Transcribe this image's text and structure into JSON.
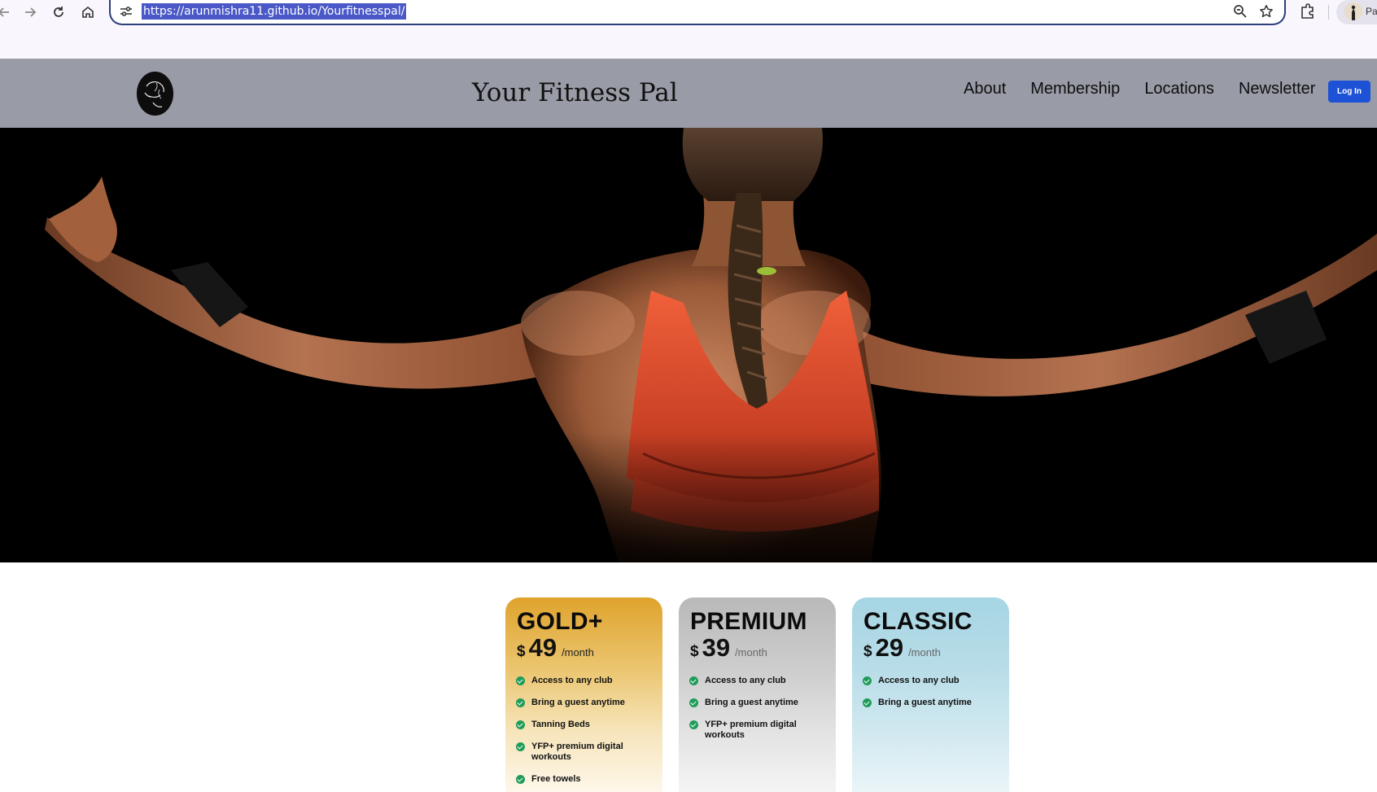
{
  "browser": {
    "url": "https://arunmishra11.github.io/Yourfitnesspal/",
    "profile_label": "Pa",
    "icons": [
      "back-icon",
      "forward-icon",
      "reload-icon",
      "home-icon",
      "site-info-icon",
      "zoom-icon",
      "bookmark-star-icon",
      "extensions-icon",
      "profile-avatar"
    ]
  },
  "header": {
    "title": "Your Fitness Pal",
    "nav": [
      "About",
      "Membership",
      "Locations",
      "Newsletter"
    ],
    "login_label": "Log In",
    "colors": {
      "header_bg": "#999ca6",
      "login_bg": "#1d52d6"
    }
  },
  "plans": [
    {
      "name": "GOLD+",
      "currency": "$",
      "price": "49",
      "period": "/month",
      "features": [
        "Access to any club",
        "Bring a guest anytime",
        "Tanning Beds",
        "YFP+ premium digital workouts",
        "Free towels"
      ],
      "color": "#dfa32c"
    },
    {
      "name": "PREMIUM",
      "currency": "$",
      "price": "39",
      "period": "/month",
      "features": [
        "Access to any club",
        "Bring a guest anytime",
        "YFP+ premium digital workouts"
      ],
      "color": "#b9b9b9"
    },
    {
      "name": "CLASSIC",
      "currency": "$",
      "price": "29",
      "period": "/month",
      "features": [
        "Access to any club",
        "Bring a guest anytime"
      ],
      "color": "#a6d5e3"
    }
  ],
  "colors": {
    "check": "#1f9c5a",
    "url_highlight": "#4a59c7"
  }
}
